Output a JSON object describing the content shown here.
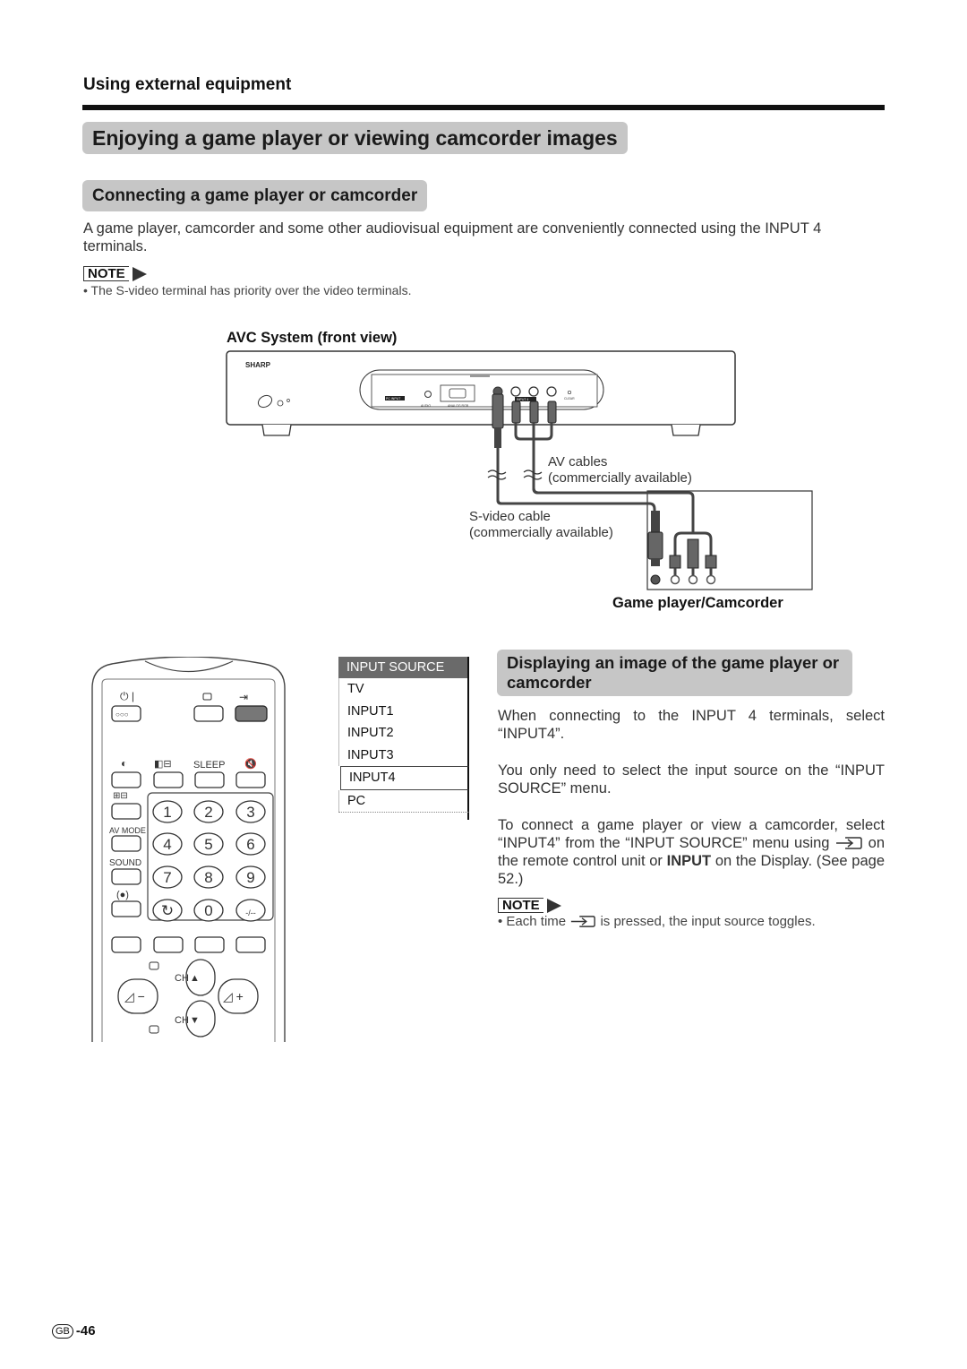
{
  "header": {
    "section": "Using external equipment",
    "title": "Enjoying a game player or viewing camcorder images"
  },
  "connecting": {
    "heading": "Connecting a game player or camcorder",
    "intro": "A game player, camcorder and some other audiovisual equipment are conveniently connected using the INPUT 4 terminals.",
    "note_label": "NOTE",
    "note": "• The S-video terminal has priority over the video terminals."
  },
  "diagram": {
    "avc_label": "AVC System (front view)",
    "brand": "SHARP",
    "panel_labels": [
      "PC INPUT",
      "AUDIO",
      "ANALOG RGB",
      "INPUT 4",
      "CLEAR"
    ],
    "av_cables": [
      "AV cables",
      "(commercially available)"
    ],
    "svideo_cable": [
      "S-video cable",
      "(commercially available)"
    ],
    "device_label": "Game player/Camcorder"
  },
  "remote": {
    "labels": {
      "sleep": "SLEEP",
      "av_mode": "AV MODE",
      "sound": "SOUND",
      "ch_up": "CH",
      "ch_down": "CH"
    },
    "digits": [
      "1",
      "2",
      "3",
      "4",
      "5",
      "6",
      "7",
      "8",
      "9",
      "↻",
      "0",
      "-/--"
    ]
  },
  "input_menu": {
    "title": "INPUT SOURCE",
    "items": [
      "TV",
      "INPUT1",
      "INPUT2",
      "INPUT3",
      "INPUT4",
      "PC"
    ],
    "selected": "INPUT4"
  },
  "displaying": {
    "heading": "Displaying an image of the game player or camcorder",
    "p1": "When connecting to the INPUT 4 terminals, select “INPUT4”.",
    "p2": "You only need to select the input source on the “INPUT SOURCE” menu.",
    "p3_a": "To connect a game player or view a camcorder, select “INPUT4” from the “INPUT SOURCE” menu using",
    "p3_b": "on the remote control unit or",
    "p3_bold": "INPUT",
    "p3_c": "on the Display. (See page 52.)",
    "note_label": "NOTE",
    "note_a": "• Each time",
    "note_b": "is pressed, the input source toggles."
  },
  "footer": {
    "region": "GB",
    "page": "-46"
  }
}
